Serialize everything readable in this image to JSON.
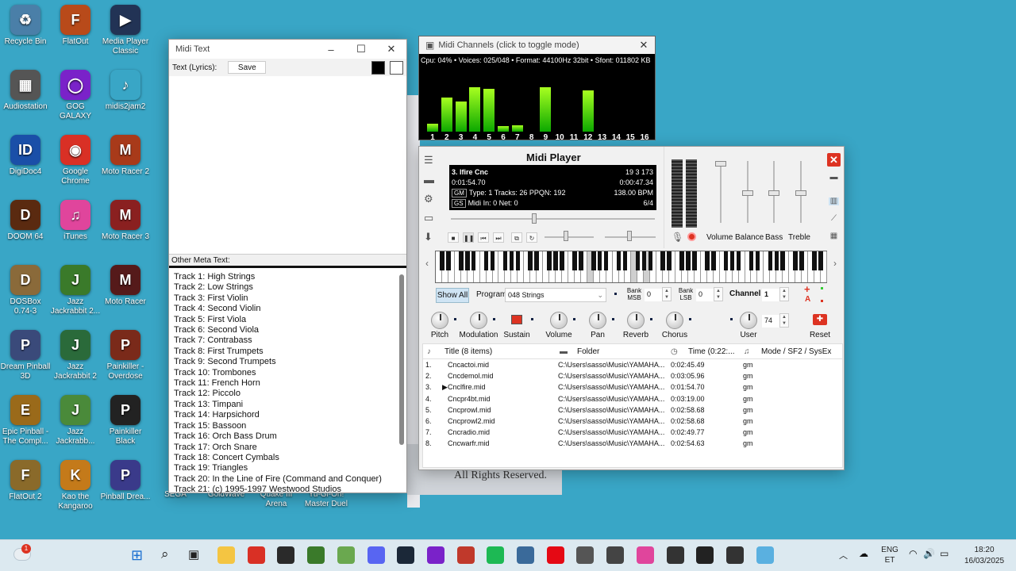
{
  "desktop": {
    "icons": [
      {
        "label": "Recycle Bin",
        "color": "#4a7fa8",
        "glyph": "♻"
      },
      {
        "label": "FlatOut",
        "color": "#b84a1a",
        "glyph": "F"
      },
      {
        "label": "Media Player Classic",
        "color": "#223355",
        "glyph": "▶"
      },
      {
        "label": "Audiostation",
        "color": "#555",
        "glyph": "▦"
      },
      {
        "label": "GOG GALAXY",
        "color": "#7a22c9",
        "glyph": "◯"
      },
      {
        "label": "midis2jam2",
        "color": "#39a6c6",
        "glyph": "♪"
      },
      {
        "label": "DigiDoc4",
        "color": "#1a4fa8",
        "glyph": "ID"
      },
      {
        "label": "Google Chrome",
        "color": "#d93025",
        "glyph": "◉"
      },
      {
        "label": "Moto Racer 2",
        "color": "#a83a1a",
        "glyph": "M"
      },
      {
        "label": "DOOM 64",
        "color": "#5a2a10",
        "glyph": "D"
      },
      {
        "label": "iTunes",
        "color": "#e0459c",
        "glyph": "♫"
      },
      {
        "label": "Moto Racer 3",
        "color": "#8a2020",
        "glyph": "M"
      },
      {
        "label": "DOSBox 0.74-3",
        "color": "#8a6a3a",
        "glyph": "D"
      },
      {
        "label": "Jazz Jackrabbit 2...",
        "color": "#3a7a2a",
        "glyph": "J"
      },
      {
        "label": "Moto Racer",
        "color": "#551a1a",
        "glyph": "M"
      },
      {
        "label": "Dream Pinball 3D",
        "color": "#3a4a7a",
        "glyph": "P"
      },
      {
        "label": "Jazz Jackrabbit 2",
        "color": "#2a6a3a",
        "glyph": "J"
      },
      {
        "label": "Painkiller - Overdose",
        "color": "#7a2a1a",
        "glyph": "P"
      },
      {
        "label": "Epic Pinball - The Compl...",
        "color": "#9a6a1a",
        "glyph": "E"
      },
      {
        "label": "Jazz Jackrabb...",
        "color": "#4a8a3a",
        "glyph": "J"
      },
      {
        "label": "Painkiller Black",
        "color": "#222",
        "glyph": "P"
      },
      {
        "label": "FlatOut 2",
        "color": "#8a6a2a",
        "glyph": "F"
      },
      {
        "label": "Kao the Kangaroo",
        "color": "#c47a1a",
        "glyph": "K"
      },
      {
        "label": "Pinball Drea...",
        "color": "#3a3a8a",
        "glyph": "P"
      }
    ],
    "partial_labels": [
      "SEGA",
      "GoldWave",
      "Quake III Arena",
      "Yu-Gi-Oh! Master Duel"
    ],
    "background_text": "All Rights Reserved."
  },
  "midi_text": {
    "title": "Midi Text",
    "text_label": "Text (Lyrics):",
    "save_label": "Save",
    "other_meta_label": "Other Meta Text:",
    "meta_lines": [
      "Track 1: High Strings",
      "Track 2: Low Strings",
      "Track 3: First Violin",
      "Track 4: Second Violin",
      "Track 5: First Viola",
      "Track 6: Second Viola",
      "Track 7: Contrabass",
      "Track 8: First Trumpets",
      "Track 9: Second Trumpets",
      "Track 10: Trombones",
      "Track 11: French Horn",
      "Track 12: Piccolo",
      "Track 13: Timpani",
      "Track 14: Harpsichord",
      "Track 15: Bassoon",
      "Track 16: Orch Bass Drum",
      "Track 17: Orch Snare",
      "Track 18: Concert Cymbals",
      "Track 19: Triangles",
      "Track 20: In the Line of Fire (Command and Conquer)",
      "Track 21: (c) 1995-1997 Westwood Studios"
    ]
  },
  "midi_channels": {
    "title": "Midi Channels (click to toggle mode)",
    "status": "Cpu: 04% • Voices: 025/048 • Format: 44100Hz 32bit • Sfont: 011802 KB",
    "channels": [
      "1",
      "2",
      "3",
      "4",
      "5",
      "6",
      "7",
      "8",
      "9",
      "10",
      "11",
      "12",
      "13",
      "14",
      "15",
      "16"
    ],
    "levels": [
      0.12,
      0.52,
      0.46,
      0.68,
      0.66,
      0.08,
      0.1,
      0,
      0.68,
      0,
      0,
      0.64,
      0,
      0,
      0,
      0
    ]
  },
  "player": {
    "title": "Midi Player",
    "track_name": "3. lfire  Cnc",
    "counters": "19   3   173",
    "elapsed": "0:01:54.70",
    "remaining": "0:00:47.34",
    "gm_tag": "GM",
    "gs_tag": "GS",
    "type_info": "Type: 1 Tracks: 26 PPQN: 192",
    "bpm": "138.00 BPM",
    "midi_in": "Midi In: 0  Net: 0",
    "time_sig": "6/4",
    "eq_labels": [
      "Volume",
      "Balance",
      "Bass",
      "Treble"
    ],
    "show_all": "Show All",
    "program_label": "Program",
    "program_value": "048 Strings",
    "bank_msb_label": "Bank MSB",
    "bank_msb_value": "0",
    "bank_lsb_label": "Bank LSB",
    "bank_lsb_value": "0",
    "channel_label": "Channel",
    "channel_value": "1",
    "knobs": [
      "Pitch",
      "Modulation",
      "Sustain",
      "Volume",
      "Pan",
      "Reverb",
      "Chorus"
    ],
    "user_label": "User",
    "user_value": "74",
    "reset_label": "Reset",
    "playlist_headers": {
      "title": "Title (8 items)",
      "folder": "Folder",
      "time": "Time (0:22:...",
      "mode": "Mode / SF2 / SysEx"
    },
    "playlist": [
      {
        "n": "1.",
        "title": "Cncactoi.mid",
        "folder": "C:\\Users\\sasso\\Music\\YAMAHA...",
        "time": "0:02:45.49",
        "mode": "gm"
      },
      {
        "n": "2.",
        "title": "Cncdemol.mid",
        "folder": "C:\\Users\\sasso\\Music\\YAMAHA...",
        "time": "0:03:05.96",
        "mode": "gm"
      },
      {
        "n": "3.",
        "title": "Cnclfire.mid",
        "folder": "C:\\Users\\sasso\\Music\\YAMAHA...",
        "time": "0:01:54.70",
        "mode": "gm"
      },
      {
        "n": "4.",
        "title": "Cncpr4bt.mid",
        "folder": "C:\\Users\\sasso\\Music\\YAMAHA...",
        "time": "0:03:19.00",
        "mode": "gm"
      },
      {
        "n": "5.",
        "title": "Cncprowl.mid",
        "folder": "C:\\Users\\sasso\\Music\\YAMAHA...",
        "time": "0:02:58.68",
        "mode": "gm"
      },
      {
        "n": "6.",
        "title": "Cncprowl2.mid",
        "folder": "C:\\Users\\sasso\\Music\\YAMAHA...",
        "time": "0:02:58.68",
        "mode": "gm"
      },
      {
        "n": "7.",
        "title": "Cncradio.mid",
        "folder": "C:\\Users\\sasso\\Music\\YAMAHA...",
        "time": "0:02:49.77",
        "mode": "gm"
      },
      {
        "n": "8.",
        "title": "Cncwarfr.mid",
        "folder": "C:\\Users\\sasso\\Music\\YAMAHA...",
        "time": "0:02:54.63",
        "mode": "gm"
      }
    ],
    "playing_index": 2
  },
  "taskbar": {
    "notification_badge": "1",
    "lang": "ENG",
    "lang_sub": "ET",
    "time": "18:20",
    "date": "16/03/2025"
  },
  "colors": {
    "desktop": "#39a6c6",
    "accent": "#d32f2f",
    "vu_green": "#7cff00"
  }
}
